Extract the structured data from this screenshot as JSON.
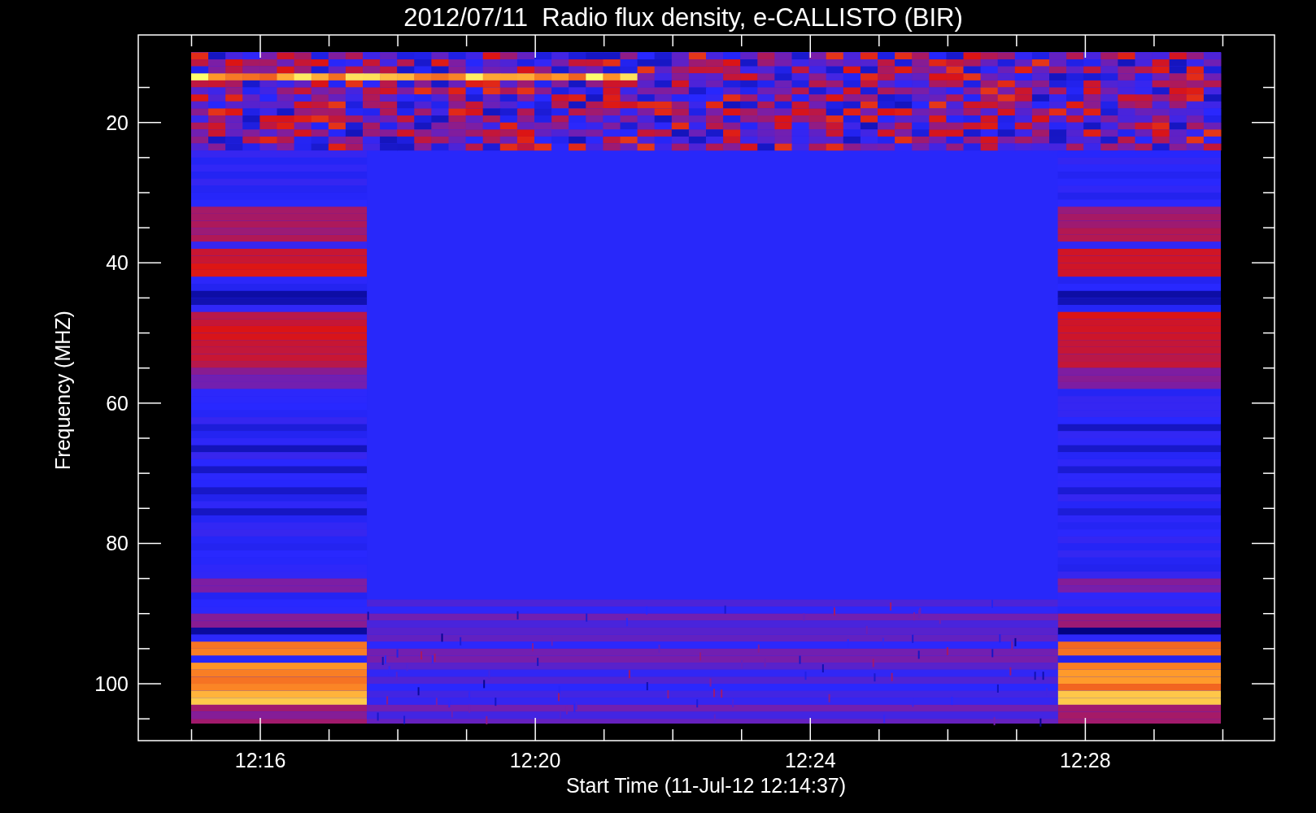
{
  "title": "2012/07/11  Radio flux density, e-CALLISTO (BIR)",
  "y_axis": {
    "label": "Frequency (MHZ)",
    "ticks": [
      "20",
      "40",
      "60",
      "80",
      "100"
    ]
  },
  "x_axis": {
    "label": "Start Time (11-Jul-12 12:14:37)",
    "ticks": [
      "12:16",
      "12:20",
      "12:24",
      "12:28"
    ]
  }
}
